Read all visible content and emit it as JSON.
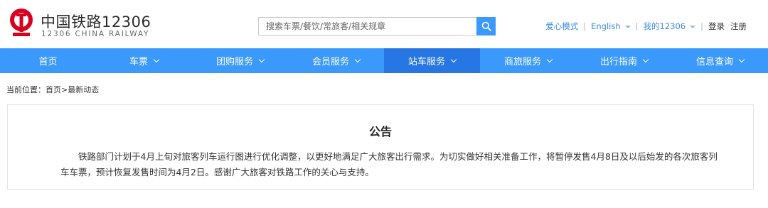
{
  "brand": {
    "name_cn": "中国铁路12306",
    "name_en": "12306 CHINA RAILWAY",
    "color": "#d8001f"
  },
  "search": {
    "placeholder": "搜索车票/餐饮/常旅客/相关规章",
    "icon": "search-icon"
  },
  "top_links": {
    "accessibility": "爱心模式",
    "language": "English",
    "my_account": "我的12306",
    "login": "登录",
    "register": "注册"
  },
  "nav": {
    "items": [
      {
        "label": "首页"
      },
      {
        "label": "车票"
      },
      {
        "label": "团购服务"
      },
      {
        "label": "会员服务"
      },
      {
        "label": "站车服务"
      },
      {
        "label": "商旅服务"
      },
      {
        "label": "出行指南"
      },
      {
        "label": "信息查询"
      }
    ],
    "active_label": "站车服务",
    "bg_color": "#3b99fc",
    "active_color": "#2676e3"
  },
  "breadcrumb": {
    "prefix": "当前位置：",
    "home": "首页",
    "separator": ">",
    "current": "最新动态"
  },
  "notice": {
    "title": "公告",
    "body": "铁路部门计划于4月上旬对旅客列车运行图进行优化调整，以更好地满足广大旅客出行需求。为切实做好相关准备工作，将暂停发售4月8日及以后始发的各次旅客列车车票，预计恢复发售时间为4月2日。感谢广大旅客对铁路工作的关心与支持。"
  }
}
